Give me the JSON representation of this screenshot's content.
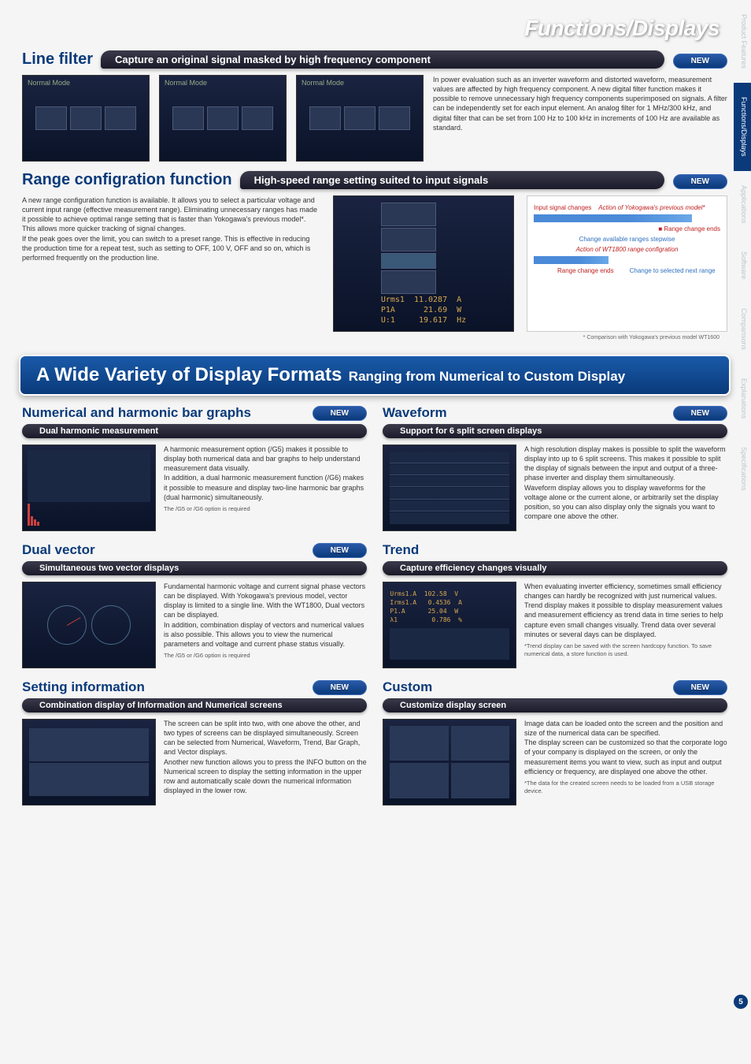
{
  "hero": "Functions/Displays",
  "badges": {
    "new": "NEW"
  },
  "side_tabs": [
    "Product Features",
    "Functions/Displays",
    "Applications",
    "Software",
    "Comparisons",
    "Explanations",
    "Specifications"
  ],
  "page_number": "5",
  "section1": {
    "title": "Line filter",
    "subtitle": "Capture an original signal masked by high frequency component",
    "body": "In power evaluation such as an inverter waveform and distorted waveform, measurement values are affected by high frequency component. A new digital filter function makes it possible to remove unnecessary high frequency components superimposed on signals. A filter can be independently set for each input element. An analog filter for 1 MHz/300 kHz, and digital filter that can be set from 100 Hz to 100 kHz in increments of 100 Hz are available as standard."
  },
  "section2": {
    "title": "Range configration function",
    "subtitle": "High-speed range setting suited to input signals",
    "body": "A new range configuration function is available. It allows you to select a particular voltage and current input range (effective measurement range). Eliminating unnecessary ranges has made it possible to achieve optimal range setting that is faster than Yokogawa's previous model*. This allows more quicker tracking of signal changes.\nIf the peak goes over the limit, you can switch to a preset range. This is effective in reducing the production time for a repeat test, such as setting to OFF, 100 V, OFF and so on, which is performed frequently on the production line.",
    "diag": {
      "l1": "Input signal changes",
      "l2": "Action of Yokogawa's previous model*",
      "l3": "Range change ends",
      "l4": "Change available ranges stepwise",
      "l5": "Action of WT1800 range configration",
      "l6": "Range change ends",
      "l7": "Change to selected next range"
    },
    "note": "* Comparison with Yokogawa's previous model WT1600"
  },
  "mega": {
    "big": "A Wide Variety of Display Formats",
    "small": "Ranging from Numerical to Custom Display"
  },
  "feat_numerical": {
    "title": "Numerical and harmonic bar graphs",
    "sub": "Dual harmonic measurement",
    "body": "A harmonic measurement option (/G5) makes it possible to display both numerical data and bar graphs to help understand measurement data visually.\nIn addition, a dual harmonic measurement function (/G6) makes it possible to measure and display two-line harmonic bar graphs (dual harmonic) simultaneously.",
    "fn": "The /G5 or /G6 option is required"
  },
  "feat_waveform": {
    "title": "Waveform",
    "sub": "Support for 6 split screen displays",
    "body": "A high resolution display makes is possible to split the waveform display into up to 6 split screens. This makes it possible to split the display of signals between the input and output of a three-phase inverter and display them simultaneously.\nWaveform display allows you to display waveforms for the voltage alone or the current alone, or arbitrarily set the display position, so you can also display only the signals you want to compare one above the other."
  },
  "feat_dualvector": {
    "title": "Dual vector",
    "sub": "Simultaneous two vector displays",
    "body": "Fundamental harmonic voltage and current signal phase vectors can be displayed. With Yokogawa's previous model, vector display is limited to a single line. With the WT1800, Dual vectors can be displayed.\nIn addition, combination display of vectors and numerical values is also possible. This allows you to view the numerical parameters and voltage and current phase status visually.",
    "fn": "The /G5 or /G6 option is required"
  },
  "feat_trend": {
    "title": "Trend",
    "sub": "Capture efficiency changes visually",
    "body": "When evaluating inverter efficiency, sometimes small efficiency changes can hardly be recognized with just numerical values.\nTrend display makes it possible to display measurement values and measurement efficiency as trend data in time series to help capture even small changes visually. Trend data over several minutes or several days can be displayed.",
    "fn": "*Trend display can be saved with the screen hardcopy function. To save numerical data, a store function is used."
  },
  "feat_setting": {
    "title": "Setting information",
    "sub": "Combination display of Information and Numerical screens",
    "body": "The screen can be split into two, with one above the other, and two types of screens can be displayed simultaneously. Screen can be selected from Numerical, Waveform, Trend, Bar Graph, and Vector displays.\nAnother new function allows you to press the INFO button on the Numerical screen to display the setting information in the upper row and automatically scale down the numerical information displayed in the lower row."
  },
  "feat_custom": {
    "title": "Custom",
    "sub": "Customize display screen",
    "body": "Image data can be loaded onto the screen and the position and size of the numerical data can be specified.\nThe display screen can be customized so that the corporate logo of your company is displayed on the screen, or only the measurement items you want to view, such as input and output efficiency or frequency, are displayed one above the other.",
    "fn": "*The data for the created screen needs to be loaded from a USB storage device."
  }
}
